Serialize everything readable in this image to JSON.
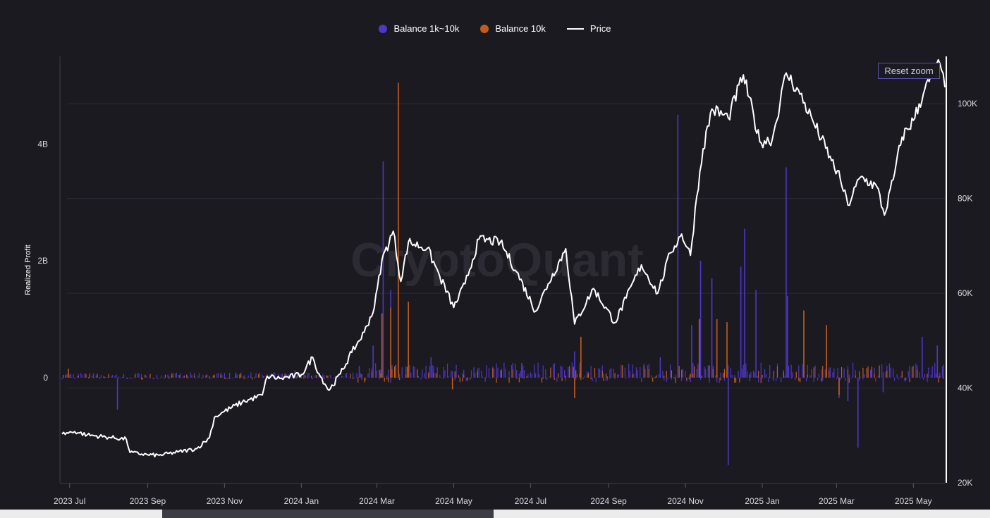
{
  "legend": [
    {
      "label": "Balance 1k~10k",
      "color": "#4f36c8",
      "shape": "circle"
    },
    {
      "label": "Balance 10k",
      "color": "#c25c1b",
      "shape": "circle"
    },
    {
      "label": "Price",
      "color": "#ffffff",
      "shape": "line"
    }
  ],
  "reset_zoom_label": "Reset zoom",
  "watermark": "CryptoQuant",
  "chart_data": {
    "type": "bar+line",
    "ylabel_left": "Realized Profit",
    "left_axis": {
      "min": -1800000000.0,
      "max": 5500000000.0,
      "ticks": [
        {
          "v": 0,
          "label": "0"
        },
        {
          "v": 2000000000.0,
          "label": "2B"
        },
        {
          "v": 4000000000.0,
          "label": "4B"
        }
      ]
    },
    "right_axis": {
      "min": 20000,
      "max": 110000,
      "ticks": [
        {
          "v": 20000,
          "label": "20K"
        },
        {
          "v": 40000,
          "label": "40K"
        },
        {
          "v": 60000,
          "label": "60K"
        },
        {
          "v": 80000,
          "label": "80K"
        },
        {
          "v": 100000,
          "label": "100K"
        }
      ]
    },
    "x_axis": {
      "start": "2023-06-25",
      "end": "2025-05-26",
      "ticks": [
        {
          "date": "2023-07-01",
          "label": "2023 Jul"
        },
        {
          "date": "2023-09-01",
          "label": "2023 Sep"
        },
        {
          "date": "2023-11-01",
          "label": "2023 Nov"
        },
        {
          "date": "2024-01-01",
          "label": "2024 Jan"
        },
        {
          "date": "2024-03-01",
          "label": "2024 Mar"
        },
        {
          "date": "2024-05-01",
          "label": "2024 May"
        },
        {
          "date": "2024-07-01",
          "label": "2024 Jul"
        },
        {
          "date": "2024-09-01",
          "label": "2024 Sep"
        },
        {
          "date": "2024-11-01",
          "label": "2024 Nov"
        },
        {
          "date": "2025-01-01",
          "label": "2025 Jan"
        },
        {
          "date": "2025-03-01",
          "label": "2025 Mar"
        },
        {
          "date": "2025-05-01",
          "label": "2025 May"
        }
      ]
    },
    "grid": "horizontal",
    "legend_position": "top-center",
    "price": [
      [
        "2023-06-25",
        30300
      ],
      [
        "2023-07-05",
        30800
      ],
      [
        "2023-07-15",
        30100
      ],
      [
        "2023-08-01",
        29600
      ],
      [
        "2023-08-15",
        29200
      ],
      [
        "2023-08-18",
        26400
      ],
      [
        "2023-09-01",
        25900
      ],
      [
        "2023-09-10",
        25800
      ],
      [
        "2023-09-25",
        26500
      ],
      [
        "2023-10-10",
        27200
      ],
      [
        "2023-10-20",
        29500
      ],
      [
        "2023-10-24",
        33800
      ],
      [
        "2023-11-01",
        35100
      ],
      [
        "2023-11-15",
        37000
      ],
      [
        "2023-12-01",
        38500
      ],
      [
        "2023-12-05",
        42500
      ],
      [
        "2023-12-15",
        42000
      ],
      [
        "2024-01-01",
        42800
      ],
      [
        "2024-01-10",
        46500
      ],
      [
        "2024-01-15",
        43000
      ],
      [
        "2024-01-23",
        39500
      ],
      [
        "2024-02-01",
        43000
      ],
      [
        "2024-02-10",
        47500
      ],
      [
        "2024-02-20",
        51800
      ],
      [
        "2024-02-28",
        57000
      ],
      [
        "2024-03-05",
        67000
      ],
      [
        "2024-03-14",
        73100
      ],
      [
        "2024-03-20",
        62500
      ],
      [
        "2024-03-26",
        70800
      ],
      [
        "2024-04-10",
        69500
      ],
      [
        "2024-04-20",
        63500
      ],
      [
        "2024-05-01",
        57000
      ],
      [
        "2024-05-10",
        62000
      ],
      [
        "2024-05-21",
        71400
      ],
      [
        "2024-06-07",
        70800
      ],
      [
        "2024-06-20",
        64500
      ],
      [
        "2024-07-05",
        56200
      ],
      [
        "2024-07-15",
        62000
      ],
      [
        "2024-07-29",
        69400
      ],
      [
        "2024-08-05",
        53500
      ],
      [
        "2024-08-20",
        61000
      ],
      [
        "2024-09-06",
        53800
      ],
      [
        "2024-09-15",
        59000
      ],
      [
        "2024-09-27",
        66000
      ],
      [
        "2024-10-10",
        60000
      ],
      [
        "2024-10-20",
        68500
      ],
      [
        "2024-10-29",
        72500
      ],
      [
        "2024-11-05",
        68000
      ],
      [
        "2024-11-10",
        80500
      ],
      [
        "2024-11-15",
        90500
      ],
      [
        "2024-11-22",
        98900
      ],
      [
        "2024-12-05",
        97000
      ],
      [
        "2024-12-17",
        106100
      ],
      [
        "2024-12-30",
        92000
      ],
      [
        "2025-01-09",
        92500
      ],
      [
        "2025-01-20",
        106500
      ],
      [
        "2025-01-31",
        102000
      ],
      [
        "2025-02-10",
        96500
      ],
      [
        "2025-02-25",
        88000
      ],
      [
        "2025-03-04",
        84000
      ],
      [
        "2025-03-10",
        78600
      ],
      [
        "2025-03-20",
        84500
      ],
      [
        "2025-04-02",
        82500
      ],
      [
        "2025-04-08",
        76500
      ],
      [
        "2025-04-15",
        84000
      ],
      [
        "2025-04-22",
        93000
      ],
      [
        "2025-05-01",
        96500
      ],
      [
        "2025-05-10",
        103000
      ],
      [
        "2025-05-22",
        108500
      ],
      [
        "2025-05-26",
        103500
      ]
    ],
    "balance_1k_10k_spikes": [
      [
        "2023-08-08",
        -550000000.0
      ],
      [
        "2023-12-27",
        120000000.0
      ],
      [
        "2024-02-16",
        200000000.0
      ],
      [
        "2024-02-27",
        550000000.0
      ],
      [
        "2024-03-06",
        3700000000.0
      ],
      [
        "2024-03-12",
        1500000000.0
      ],
      [
        "2024-04-13",
        350000000.0
      ],
      [
        "2024-06-24",
        250000000.0
      ],
      [
        "2024-08-05",
        450000000.0
      ],
      [
        "2024-10-12",
        350000000.0
      ],
      [
        "2024-10-26",
        4500000000.0
      ],
      [
        "2024-11-06",
        900000000.0
      ],
      [
        "2024-11-13",
        2000000000.0
      ],
      [
        "2024-11-22",
        1700000000.0
      ],
      [
        "2024-12-05",
        -1500000000.0
      ],
      [
        "2024-12-15",
        1900000000.0
      ],
      [
        "2024-12-18",
        2550000000.0
      ],
      [
        "2024-12-27",
        1500000000.0
      ],
      [
        "2025-01-20",
        3600000000.0
      ],
      [
        "2025-01-21",
        1400000000.0
      ],
      [
        "2025-03-03",
        -350000000.0
      ],
      [
        "2025-03-10",
        -400000000.0
      ],
      [
        "2025-03-18",
        -1200000000.0
      ],
      [
        "2025-04-07",
        -250000000.0
      ],
      [
        "2025-05-08",
        700000000.0
      ],
      [
        "2025-05-20",
        550000000.0
      ]
    ],
    "balance_10k_spikes": [
      [
        "2023-06-30",
        150000000.0
      ],
      [
        "2024-03-05",
        1100000000.0
      ],
      [
        "2024-03-12",
        1200000000.0
      ],
      [
        "2024-03-18",
        5050000000.0
      ],
      [
        "2024-03-26",
        1300000000.0
      ],
      [
        "2024-04-30",
        -200000000.0
      ],
      [
        "2024-08-05",
        -350000000.0
      ],
      [
        "2024-08-10",
        700000000.0
      ],
      [
        "2024-11-12",
        1000000000.0
      ],
      [
        "2024-11-26",
        1000000000.0
      ],
      [
        "2024-12-04",
        950000000.0
      ],
      [
        "2025-02-03",
        1150000000.0
      ],
      [
        "2025-02-21",
        900000000.0
      ],
      [
        "2025-03-03",
        -300000000.0
      ]
    ]
  }
}
